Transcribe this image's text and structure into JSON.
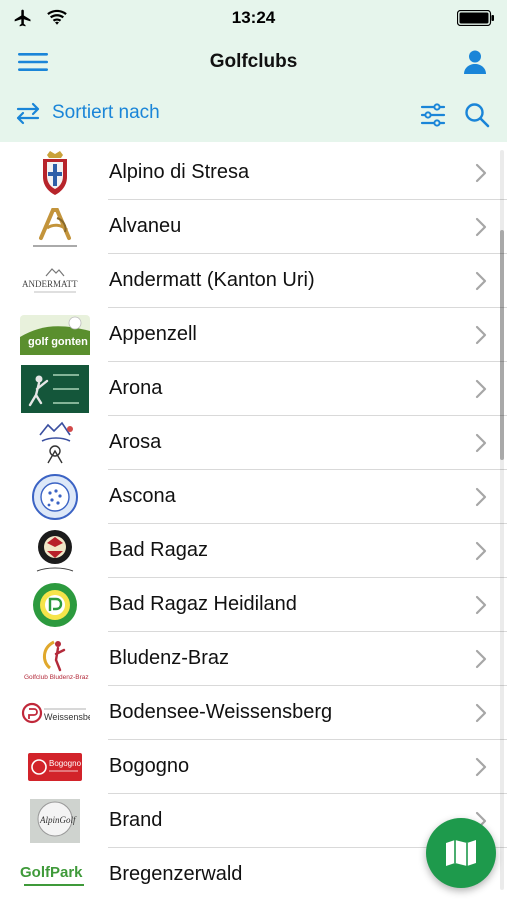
{
  "status_bar": {
    "time": "13:24",
    "icons": [
      "airplane-icon",
      "wifi-icon",
      "battery-icon"
    ]
  },
  "nav": {
    "title": "Golfclubs",
    "menu_icon": "hamburger-menu-icon",
    "user_icon": "user-profile-icon"
  },
  "sort_bar": {
    "label": "Sortiert nach",
    "sort_icon": "sort-arrows-icon",
    "filter_icon": "filter-sliders-icon",
    "search_icon": "search-icon"
  },
  "colors": {
    "header_bg": "#e6f5ec",
    "accent_blue": "#1a85d8",
    "fab_green": "#1e9a4c"
  },
  "clubs": [
    {
      "name": "Alpino di Stresa",
      "logo": "crest-logo"
    },
    {
      "name": "Alvaneu",
      "logo": "gold-monogram-logo"
    },
    {
      "name": "Andermatt (Kanton Uri)",
      "logo": "andermatt-wordmark-logo",
      "logo_text": "ANDERMATT"
    },
    {
      "name": "Appenzell",
      "logo": "golf-gonten-logo",
      "logo_text": "golf gonten"
    },
    {
      "name": "Arona",
      "logo": "arona-golf-club-logo"
    },
    {
      "name": "Arosa",
      "logo": "arosa-golf-logo"
    },
    {
      "name": "Ascona",
      "logo": "golf-club-patriziale-ascona-logo"
    },
    {
      "name": "Bad Ragaz",
      "logo": "bad-ragaz-badge-logo"
    },
    {
      "name": "Bad Ragaz Heidiland",
      "logo": "golf-club-heidiland-logo"
    },
    {
      "name": "Bludenz-Braz",
      "logo": "golfclub-bludenz-braz-logo",
      "logo_text": "Golfclub Bludenz-Braz"
    },
    {
      "name": "Bodensee-Weissensberg",
      "logo": "golfclub-bodensee-weissensberg-logo",
      "logo_text": "Weissensberg"
    },
    {
      "name": "Bogogno",
      "logo": "bogogno-golf-resort-logo",
      "logo_text": "Bogogno"
    },
    {
      "name": "Brand",
      "logo": "alpengolf-brand-logo",
      "logo_text": "AlpinGolf"
    },
    {
      "name": "Bregenzerwald",
      "logo": "golfpark-bregenzerwald-logo",
      "logo_text": "GolfPark"
    }
  ],
  "fab": {
    "icon": "map-icon"
  }
}
